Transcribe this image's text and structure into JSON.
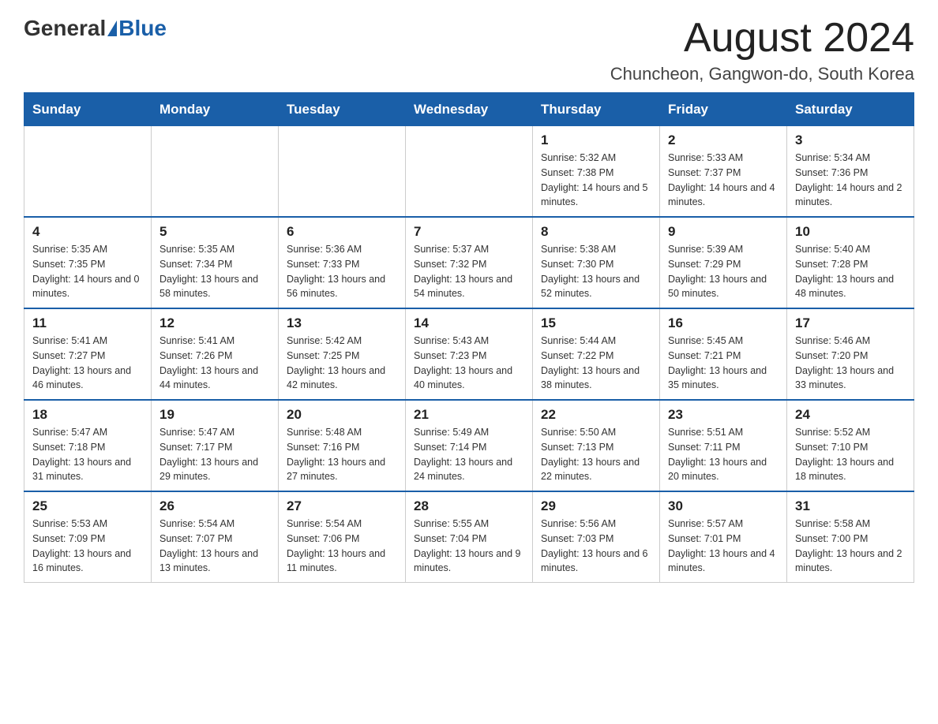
{
  "logo": {
    "general": "General",
    "blue": "Blue"
  },
  "header": {
    "month_year": "August 2024",
    "location": "Chuncheon, Gangwon-do, South Korea"
  },
  "weekdays": [
    "Sunday",
    "Monday",
    "Tuesday",
    "Wednesday",
    "Thursday",
    "Friday",
    "Saturday"
  ],
  "weeks": [
    [
      {
        "day": "",
        "sunrise": "",
        "sunset": "",
        "daylight": ""
      },
      {
        "day": "",
        "sunrise": "",
        "sunset": "",
        "daylight": ""
      },
      {
        "day": "",
        "sunrise": "",
        "sunset": "",
        "daylight": ""
      },
      {
        "day": "",
        "sunrise": "",
        "sunset": "",
        "daylight": ""
      },
      {
        "day": "1",
        "sunrise": "Sunrise: 5:32 AM",
        "sunset": "Sunset: 7:38 PM",
        "daylight": "Daylight: 14 hours and 5 minutes."
      },
      {
        "day": "2",
        "sunrise": "Sunrise: 5:33 AM",
        "sunset": "Sunset: 7:37 PM",
        "daylight": "Daylight: 14 hours and 4 minutes."
      },
      {
        "day": "3",
        "sunrise": "Sunrise: 5:34 AM",
        "sunset": "Sunset: 7:36 PM",
        "daylight": "Daylight: 14 hours and 2 minutes."
      }
    ],
    [
      {
        "day": "4",
        "sunrise": "Sunrise: 5:35 AM",
        "sunset": "Sunset: 7:35 PM",
        "daylight": "Daylight: 14 hours and 0 minutes."
      },
      {
        "day": "5",
        "sunrise": "Sunrise: 5:35 AM",
        "sunset": "Sunset: 7:34 PM",
        "daylight": "Daylight: 13 hours and 58 minutes."
      },
      {
        "day": "6",
        "sunrise": "Sunrise: 5:36 AM",
        "sunset": "Sunset: 7:33 PM",
        "daylight": "Daylight: 13 hours and 56 minutes."
      },
      {
        "day": "7",
        "sunrise": "Sunrise: 5:37 AM",
        "sunset": "Sunset: 7:32 PM",
        "daylight": "Daylight: 13 hours and 54 minutes."
      },
      {
        "day": "8",
        "sunrise": "Sunrise: 5:38 AM",
        "sunset": "Sunset: 7:30 PM",
        "daylight": "Daylight: 13 hours and 52 minutes."
      },
      {
        "day": "9",
        "sunrise": "Sunrise: 5:39 AM",
        "sunset": "Sunset: 7:29 PM",
        "daylight": "Daylight: 13 hours and 50 minutes."
      },
      {
        "day": "10",
        "sunrise": "Sunrise: 5:40 AM",
        "sunset": "Sunset: 7:28 PM",
        "daylight": "Daylight: 13 hours and 48 minutes."
      }
    ],
    [
      {
        "day": "11",
        "sunrise": "Sunrise: 5:41 AM",
        "sunset": "Sunset: 7:27 PM",
        "daylight": "Daylight: 13 hours and 46 minutes."
      },
      {
        "day": "12",
        "sunrise": "Sunrise: 5:41 AM",
        "sunset": "Sunset: 7:26 PM",
        "daylight": "Daylight: 13 hours and 44 minutes."
      },
      {
        "day": "13",
        "sunrise": "Sunrise: 5:42 AM",
        "sunset": "Sunset: 7:25 PM",
        "daylight": "Daylight: 13 hours and 42 minutes."
      },
      {
        "day": "14",
        "sunrise": "Sunrise: 5:43 AM",
        "sunset": "Sunset: 7:23 PM",
        "daylight": "Daylight: 13 hours and 40 minutes."
      },
      {
        "day": "15",
        "sunrise": "Sunrise: 5:44 AM",
        "sunset": "Sunset: 7:22 PM",
        "daylight": "Daylight: 13 hours and 38 minutes."
      },
      {
        "day": "16",
        "sunrise": "Sunrise: 5:45 AM",
        "sunset": "Sunset: 7:21 PM",
        "daylight": "Daylight: 13 hours and 35 minutes."
      },
      {
        "day": "17",
        "sunrise": "Sunrise: 5:46 AM",
        "sunset": "Sunset: 7:20 PM",
        "daylight": "Daylight: 13 hours and 33 minutes."
      }
    ],
    [
      {
        "day": "18",
        "sunrise": "Sunrise: 5:47 AM",
        "sunset": "Sunset: 7:18 PM",
        "daylight": "Daylight: 13 hours and 31 minutes."
      },
      {
        "day": "19",
        "sunrise": "Sunrise: 5:47 AM",
        "sunset": "Sunset: 7:17 PM",
        "daylight": "Daylight: 13 hours and 29 minutes."
      },
      {
        "day": "20",
        "sunrise": "Sunrise: 5:48 AM",
        "sunset": "Sunset: 7:16 PM",
        "daylight": "Daylight: 13 hours and 27 minutes."
      },
      {
        "day": "21",
        "sunrise": "Sunrise: 5:49 AM",
        "sunset": "Sunset: 7:14 PM",
        "daylight": "Daylight: 13 hours and 24 minutes."
      },
      {
        "day": "22",
        "sunrise": "Sunrise: 5:50 AM",
        "sunset": "Sunset: 7:13 PM",
        "daylight": "Daylight: 13 hours and 22 minutes."
      },
      {
        "day": "23",
        "sunrise": "Sunrise: 5:51 AM",
        "sunset": "Sunset: 7:11 PM",
        "daylight": "Daylight: 13 hours and 20 minutes."
      },
      {
        "day": "24",
        "sunrise": "Sunrise: 5:52 AM",
        "sunset": "Sunset: 7:10 PM",
        "daylight": "Daylight: 13 hours and 18 minutes."
      }
    ],
    [
      {
        "day": "25",
        "sunrise": "Sunrise: 5:53 AM",
        "sunset": "Sunset: 7:09 PM",
        "daylight": "Daylight: 13 hours and 16 minutes."
      },
      {
        "day": "26",
        "sunrise": "Sunrise: 5:54 AM",
        "sunset": "Sunset: 7:07 PM",
        "daylight": "Daylight: 13 hours and 13 minutes."
      },
      {
        "day": "27",
        "sunrise": "Sunrise: 5:54 AM",
        "sunset": "Sunset: 7:06 PM",
        "daylight": "Daylight: 13 hours and 11 minutes."
      },
      {
        "day": "28",
        "sunrise": "Sunrise: 5:55 AM",
        "sunset": "Sunset: 7:04 PM",
        "daylight": "Daylight: 13 hours and 9 minutes."
      },
      {
        "day": "29",
        "sunrise": "Sunrise: 5:56 AM",
        "sunset": "Sunset: 7:03 PM",
        "daylight": "Daylight: 13 hours and 6 minutes."
      },
      {
        "day": "30",
        "sunrise": "Sunrise: 5:57 AM",
        "sunset": "Sunset: 7:01 PM",
        "daylight": "Daylight: 13 hours and 4 minutes."
      },
      {
        "day": "31",
        "sunrise": "Sunrise: 5:58 AM",
        "sunset": "Sunset: 7:00 PM",
        "daylight": "Daylight: 13 hours and 2 minutes."
      }
    ]
  ]
}
